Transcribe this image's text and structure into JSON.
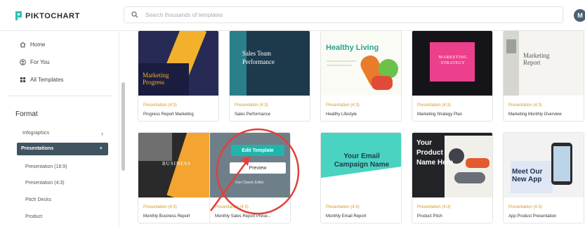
{
  "app": {
    "brand": "PIKTOCHART",
    "brand_color": "#2ec4b6",
    "accent_color": "#d89620",
    "active_bg": "#3f5361"
  },
  "search": {
    "placeholder": "Search thousands of templates",
    "icon": "search-icon"
  },
  "user": {
    "avatar_initial": "M"
  },
  "sidebar": {
    "nav": [
      {
        "label": "Home",
        "icon": "home-icon"
      },
      {
        "label": "For You",
        "icon": "user-circle-icon"
      },
      {
        "label": "All Templates",
        "icon": "grid-icon"
      }
    ],
    "format_title": "Format",
    "formats": [
      {
        "label": "Infographics",
        "expanded": false
      },
      {
        "label": "Presentations",
        "expanded": true,
        "active": true
      }
    ],
    "presentation_sub": [
      "Presentation (16:9)",
      "Presentation (4:3)",
      "Pitch Decks",
      "Product"
    ]
  },
  "templates": [
    {
      "category": "Presentation (4:3)",
      "name": "Progress Report Marketing",
      "thumb_title": "Marketing Progress"
    },
    {
      "category": "Presentation (4:3)",
      "name": "Sales Performance",
      "thumb_title": "Sales Team Performance"
    },
    {
      "category": "Presentation (4:3)",
      "name": "Healthy Lifestyle",
      "thumb_title": "Healthy Living"
    },
    {
      "category": "Presentation (4:3)",
      "name": "Marketing Strategy Plan",
      "thumb_title": "MARKETING STRATEGY"
    },
    {
      "category": "Presentation (4:3)",
      "name": "Marketing Monthly Overview",
      "thumb_title": "Marketing Report"
    },
    {
      "category": "Presentation (4:3)",
      "name": "Monthly Business Report",
      "thumb_title": "BUSINESS"
    },
    {
      "category": "Presentation (4:3)",
      "name": "Monthly Sales Report Prese...",
      "thumb_title": "",
      "hover": {
        "edit_label": "Edit Template",
        "preview_label": "Preview",
        "secondary_link": "Use Classic Editor"
      }
    },
    {
      "category": "Presentation (4:3)",
      "name": "Monthly Email Report",
      "thumb_title": "Your Email Campaign Name"
    },
    {
      "category": "Presentation (4:3)",
      "name": "Product Pitch",
      "thumb_title": "Your Product Name Here"
    },
    {
      "category": "Presentation (4:3)",
      "name": "App Product Presentation",
      "thumb_title": "Meet Our New App"
    }
  ],
  "annotation_color": "#e2403a"
}
